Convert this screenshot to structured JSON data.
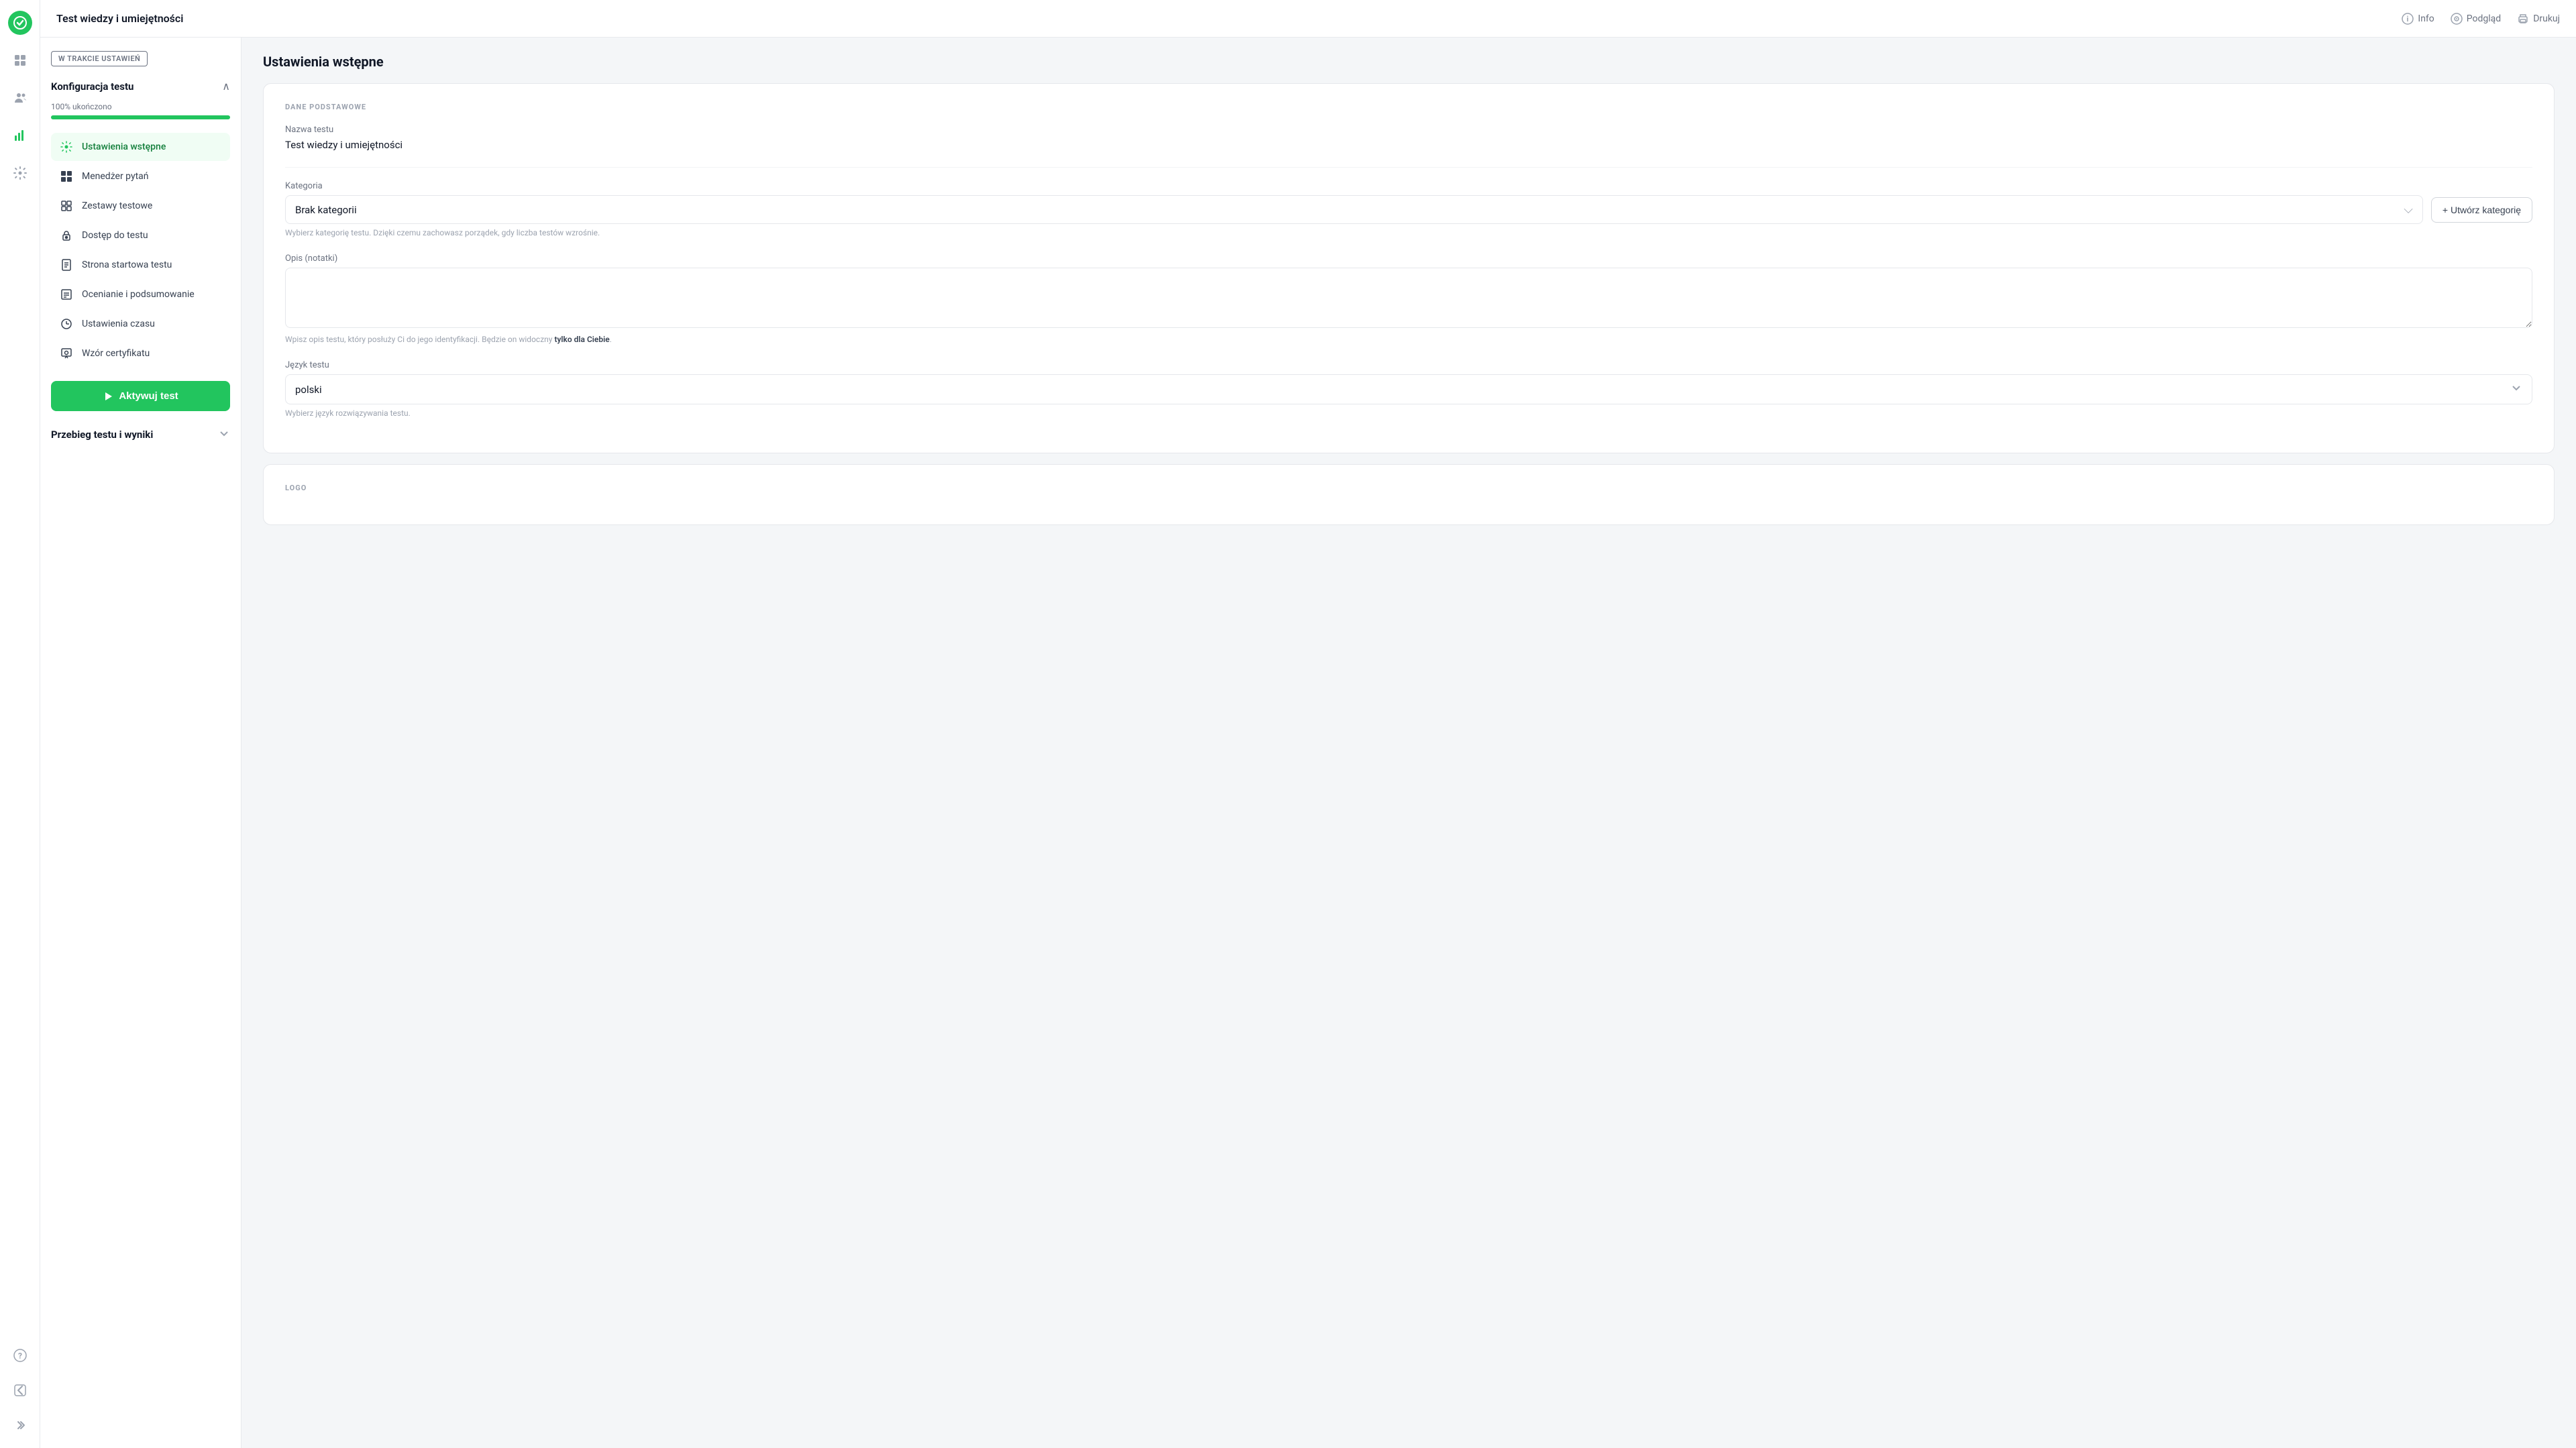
{
  "app": {
    "logo_symbol": "✓",
    "title": "Test wiedzy i umiejętności"
  },
  "topbar": {
    "title": "Test wiedzy i umiejętności",
    "info_label": "Info",
    "preview_label": "Podgląd",
    "print_label": "Drukuj"
  },
  "sidebar": {
    "status_badge": "W TRAKCIE USTAWIEŃ",
    "section_title": "Konfiguracja testu",
    "progress_label": "100% ukończono",
    "progress_percent": 100,
    "menu_items": [
      {
        "id": "ustawienia-wstepne",
        "label": "Ustawienia wstępne",
        "active": true,
        "icon": "⚙"
      },
      {
        "id": "menedzer-pytan",
        "label": "Menedżer pytań",
        "active": false,
        "icon": "⊞"
      },
      {
        "id": "zestawy-testowe",
        "label": "Zestawy testowe",
        "active": false,
        "icon": "▦"
      },
      {
        "id": "dostep-do-testu",
        "label": "Dostęp do testu",
        "active": false,
        "icon": "🔒"
      },
      {
        "id": "strona-startowa",
        "label": "Strona startowa testu",
        "active": false,
        "icon": "📄"
      },
      {
        "id": "ocenianie",
        "label": "Ocenianie i podsumowanie",
        "active": false,
        "icon": "📋"
      },
      {
        "id": "ustawienia-czasu",
        "label": "Ustawienia czasu",
        "active": false,
        "icon": "🕐"
      },
      {
        "id": "wzor-certyfikatu",
        "label": "Wzór certyfikatu",
        "active": false,
        "icon": "🏅"
      }
    ],
    "activate_button": "Aktywuj test",
    "section2_title": "Przebieg testu i wyniki"
  },
  "main": {
    "page_title": "Ustawienia wstępne",
    "card1": {
      "section_label": "DANE PODSTAWOWE",
      "test_name_label": "Nazwa testu",
      "test_name_value": "Test wiedzy i umiejętności",
      "category_label": "Kategoria",
      "category_value": "Brak kategorii",
      "category_hint": "Wybierz kategorię testu. Dzięki czemu zachowasz porządek, gdy liczba testów wzrośnie.",
      "create_category_btn": "+ Utwórz kategorię",
      "description_label": "Opis (notatki)",
      "description_placeholder": "",
      "description_hint_normal": "Wpisz opis testu, który posłuży Ci do jego identyfikacji. Będzie on widoczny ",
      "description_hint_bold": "tylko dla Ciebie",
      "description_hint_end": ".",
      "language_label": "Język testu",
      "language_value": "polski",
      "language_hint": "Wybierz język rozwiązywania testu."
    },
    "card2": {
      "section_label": "LOGO"
    }
  },
  "nav_icons": {
    "apps_icon": "⊞",
    "users_icon": "👥",
    "chart_icon": "📊",
    "settings_icon": "⚙",
    "help_icon": "?",
    "back_icon": "←",
    "expand_icon": "»"
  }
}
